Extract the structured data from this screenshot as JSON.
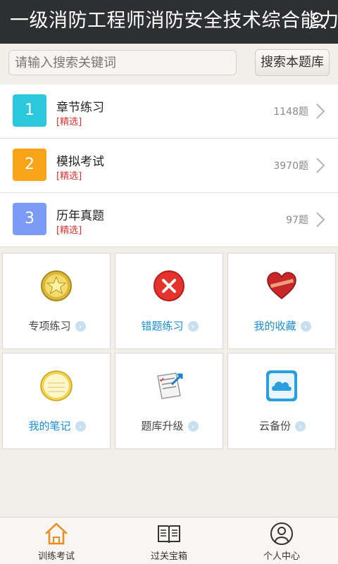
{
  "header": {
    "title": "一级消防工程师消防安全技术综合能力"
  },
  "search": {
    "placeholder": "请输入搜索关键词",
    "button_label": "搜索本题库"
  },
  "sections": [
    {
      "number": "1",
      "name": "章节练习",
      "tag": "[精选]",
      "count": "1148题",
      "color": "#2bc7dc"
    },
    {
      "number": "2",
      "name": "模拟考试",
      "tag": "[精选]",
      "count": "3970题",
      "color": "#f7a419"
    },
    {
      "number": "3",
      "name": "历年真题",
      "tag": "[精选]",
      "count": "97题",
      "color": "#7c9bf4"
    }
  ],
  "features": [
    {
      "label": "专项练习",
      "icon": "star-badge-icon",
      "label_color": "#444444"
    },
    {
      "label": "错题练习",
      "icon": "red-x-icon",
      "label_color": "#1a8fd6"
    },
    {
      "label": "我的收藏",
      "icon": "heart-icon",
      "label_color": "#1a8fd6"
    },
    {
      "label": "我的笔记",
      "icon": "notepad-icon",
      "label_color": "#1a8fd6"
    },
    {
      "label": "题库升级",
      "icon": "document-upgrade-icon",
      "label_color": "#444444"
    },
    {
      "label": "云备份",
      "icon": "cloud-icon",
      "label_color": "#444444"
    }
  ],
  "tabs": [
    {
      "label": "训练考试",
      "icon": "home-icon",
      "active": true
    },
    {
      "label": "过关宝箱",
      "icon": "book-icon",
      "active": false
    },
    {
      "label": "个人中心",
      "icon": "user-icon",
      "active": false
    }
  ]
}
